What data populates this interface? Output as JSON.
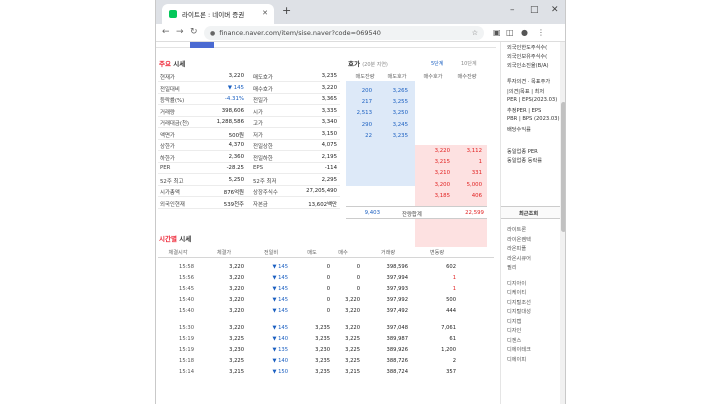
{
  "browser": {
    "tab_title": "라이트론 : 네이버 증권",
    "tab_close": "✕",
    "new_tab": "+",
    "win_min": "–",
    "win_max": "□",
    "win_close": "✕",
    "back": "←",
    "forward": "→",
    "reload": "↻",
    "url": "finance.naver.com/item/sise.naver?code=069540",
    "star": "☆"
  },
  "quote": {
    "title_main": "주요",
    "title_rest": "시세",
    "rows": [
      {
        "l1": "현재가",
        "v1": "3,220",
        "c1": "",
        "l2": "매도호가",
        "v2": "3,235"
      },
      {
        "l1": "전일대비",
        "v1": "▼ 145",
        "c1": "blue",
        "l2": "매수호가",
        "v2": "3,220"
      },
      {
        "l1": "등락률(%)",
        "v1": "-4.31%",
        "c1": "blue",
        "l2": "전일가",
        "v2": "3,365"
      },
      {
        "l1": "거래량",
        "v1": "398,606",
        "c1": "",
        "l2": "시가",
        "v2": "3,335"
      },
      {
        "l1": "거래대금(천)",
        "v1": "1,288,586",
        "c1": "",
        "l2": "고가",
        "v2": "3,340"
      },
      {
        "l1": "액면가",
        "v1": "500원",
        "c1": "",
        "l2": "저가",
        "v2": "3,150"
      },
      {
        "l1": "상한가",
        "v1": "4,370",
        "c1": "",
        "l2": "전일상한",
        "v2": "4,075"
      },
      {
        "l1": "하한가",
        "v1": "2,360",
        "c1": "",
        "l2": "전일하한",
        "v2": "2,195"
      },
      {
        "l1": "PER",
        "v1": "-28.25",
        "c1": "",
        "l2": "EPS",
        "v2": "-114"
      },
      {
        "l1": "52주 최고",
        "v1": "5,250",
        "c1": "",
        "l2": "52주 최저",
        "v2": "2,295"
      },
      {
        "l1": "시가총액",
        "v1": "876억원",
        "c1": "",
        "l2": "상장주식수",
        "v2": "27,205,490"
      },
      {
        "l1": "외국인현재",
        "v1": "539천주",
        "c1": "",
        "l2": "자본금",
        "v2": "13,602백만"
      }
    ]
  },
  "orderbook": {
    "title": "호가",
    "subtitle": "(20분 지연)",
    "link1": "5단계",
    "link2": "10단계",
    "headers": [
      "매도잔량",
      "매도호가",
      "매수호가",
      "매수잔량"
    ],
    "asks": [
      {
        "qty": "200",
        "price": "3,265"
      },
      {
        "qty": "217",
        "price": "3,255"
      },
      {
        "qty": "2,513",
        "price": "3,250"
      },
      {
        "qty": "290",
        "price": "3,245"
      },
      {
        "qty": "22",
        "price": "3,235"
      }
    ],
    "bids": [
      {
        "price": "3,220",
        "qty": "3,112"
      },
      {
        "price": "3,215",
        "qty": "1"
      },
      {
        "price": "3,210",
        "qty": "331"
      },
      {
        "price": "3,200",
        "qty": "5,000"
      },
      {
        "price": "3,185",
        "qty": "406"
      }
    ],
    "total_ask": "9,403",
    "total_label": "잔량합계",
    "total_bid": "22,599"
  },
  "timeseries": {
    "title_main": "시간별",
    "title_rest": "시세",
    "headers": [
      "체결시각",
      "체결가",
      "전일비",
      "매도",
      "매수",
      "거래량",
      "변동량"
    ],
    "rows": [
      {
        "t": "15:58",
        "p": "3,220",
        "d": "▼ 145",
        "s": "0",
        "b": "0",
        "v": "398,596",
        "c": "602",
        "cc": ""
      },
      {
        "t": "15:56",
        "p": "3,220",
        "d": "▼ 145",
        "s": "0",
        "b": "0",
        "v": "397,994",
        "c": "1",
        "cc": "red"
      },
      {
        "t": "15:45",
        "p": "3,220",
        "d": "▼ 145",
        "s": "0",
        "b": "0",
        "v": "397,993",
        "c": "1",
        "cc": "red"
      },
      {
        "t": "15:40",
        "p": "3,220",
        "d": "▼ 145",
        "s": "0",
        "b": "3,220",
        "v": "397,992",
        "c": "500",
        "cc": ""
      },
      {
        "t": "15:40",
        "p": "3,220",
        "d": "▼ 145",
        "s": "0",
        "b": "3,220",
        "v": "397,492",
        "c": "444",
        "cc": ""
      },
      {
        "t": "15:30",
        "p": "3,220",
        "d": "▼ 145",
        "s": "3,235",
        "b": "3,220",
        "v": "397,048",
        "c": "7,061",
        "cc": ""
      },
      {
        "t": "15:19",
        "p": "3,225",
        "d": "▼ 140",
        "s": "3,235",
        "b": "3,225",
        "v": "389,987",
        "c": "61",
        "cc": ""
      },
      {
        "t": "15:19",
        "p": "3,230",
        "d": "▼ 135",
        "s": "3,230",
        "b": "3,225",
        "v": "389,926",
        "c": "1,200",
        "cc": ""
      },
      {
        "t": "15:18",
        "p": "3,225",
        "d": "▼ 140",
        "s": "3,235",
        "b": "3,225",
        "v": "388,726",
        "c": "2",
        "cc": ""
      },
      {
        "t": "15:14",
        "p": "3,215",
        "d": "▼ 150",
        "s": "3,235",
        "b": "3,215",
        "v": "388,724",
        "c": "357",
        "cc": ""
      }
    ]
  },
  "side": {
    "top_items": [
      "외국인한도주식수(",
      "외국인보유주식수(",
      "외국인소진율(B/A)"
    ],
    "mid_items": [
      "투자의견 · 목표주가",
      "|의견|목표 | 최저",
      "PER | EPS(2023.03)",
      "추정PER | EPS",
      "PBR | BPS (2023.03)",
      "배당수익률"
    ],
    "sector_items": [
      "동일업종 PER",
      "동일업종 등락률"
    ],
    "recent_title": "최근조회",
    "recent_items": [
      "라이트론",
      "라이온켐텍",
      "라온피플",
      "라온시큐어",
      "필리",
      "디지아이",
      "디케이티",
      "디지털조선",
      "디지털대성",
      "디지캡",
      "디자인",
      "디젠스",
      "디에이테크",
      "디에이피"
    ]
  }
}
